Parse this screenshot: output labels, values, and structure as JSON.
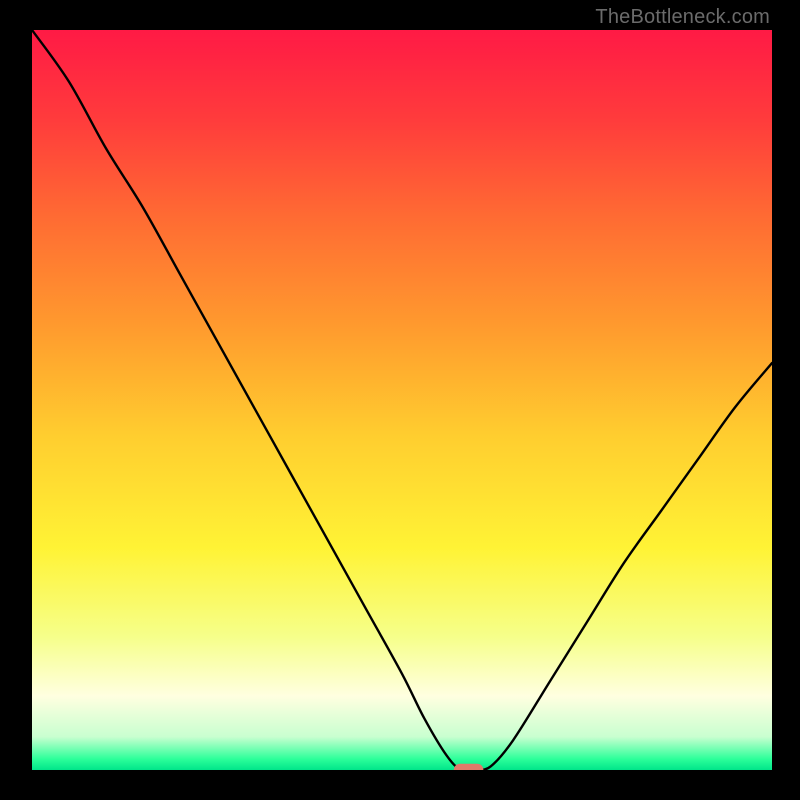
{
  "watermark": "TheBottleneck.com",
  "chart_data": {
    "type": "line",
    "title": "",
    "xlabel": "",
    "ylabel": "",
    "xlim": [
      0,
      100
    ],
    "ylim": [
      0,
      100
    ],
    "grid": false,
    "legend": false,
    "background_gradient": {
      "stops": [
        {
          "pos": 0.0,
          "color": "#ff1a45"
        },
        {
          "pos": 0.12,
          "color": "#ff3b3c"
        },
        {
          "pos": 0.25,
          "color": "#ff6a33"
        },
        {
          "pos": 0.4,
          "color": "#ff9a2e"
        },
        {
          "pos": 0.55,
          "color": "#ffce2f"
        },
        {
          "pos": 0.7,
          "color": "#fff335"
        },
        {
          "pos": 0.82,
          "color": "#f6ff8a"
        },
        {
          "pos": 0.9,
          "color": "#ffffe0"
        },
        {
          "pos": 0.955,
          "color": "#c9ffd0"
        },
        {
          "pos": 0.985,
          "color": "#2dff9a"
        },
        {
          "pos": 1.0,
          "color": "#00e58a"
        }
      ]
    },
    "series": [
      {
        "name": "bottleneck-curve",
        "color": "#000000",
        "x": [
          0,
          5,
          10,
          15,
          20,
          25,
          30,
          35,
          40,
          45,
          50,
          53,
          56,
          58,
          60,
          62,
          65,
          70,
          75,
          80,
          85,
          90,
          95,
          100
        ],
        "y": [
          100,
          93,
          84,
          76,
          67,
          58,
          49,
          40,
          31,
          22,
          13,
          7,
          2,
          0,
          0,
          0.5,
          4,
          12,
          20,
          28,
          35,
          42,
          49,
          55
        ]
      }
    ],
    "marker": {
      "name": "optimal-marker",
      "x": 59,
      "y": 0,
      "width_pct": 4.0,
      "height_pct": 1.7,
      "fill": "#e07a6a"
    }
  }
}
